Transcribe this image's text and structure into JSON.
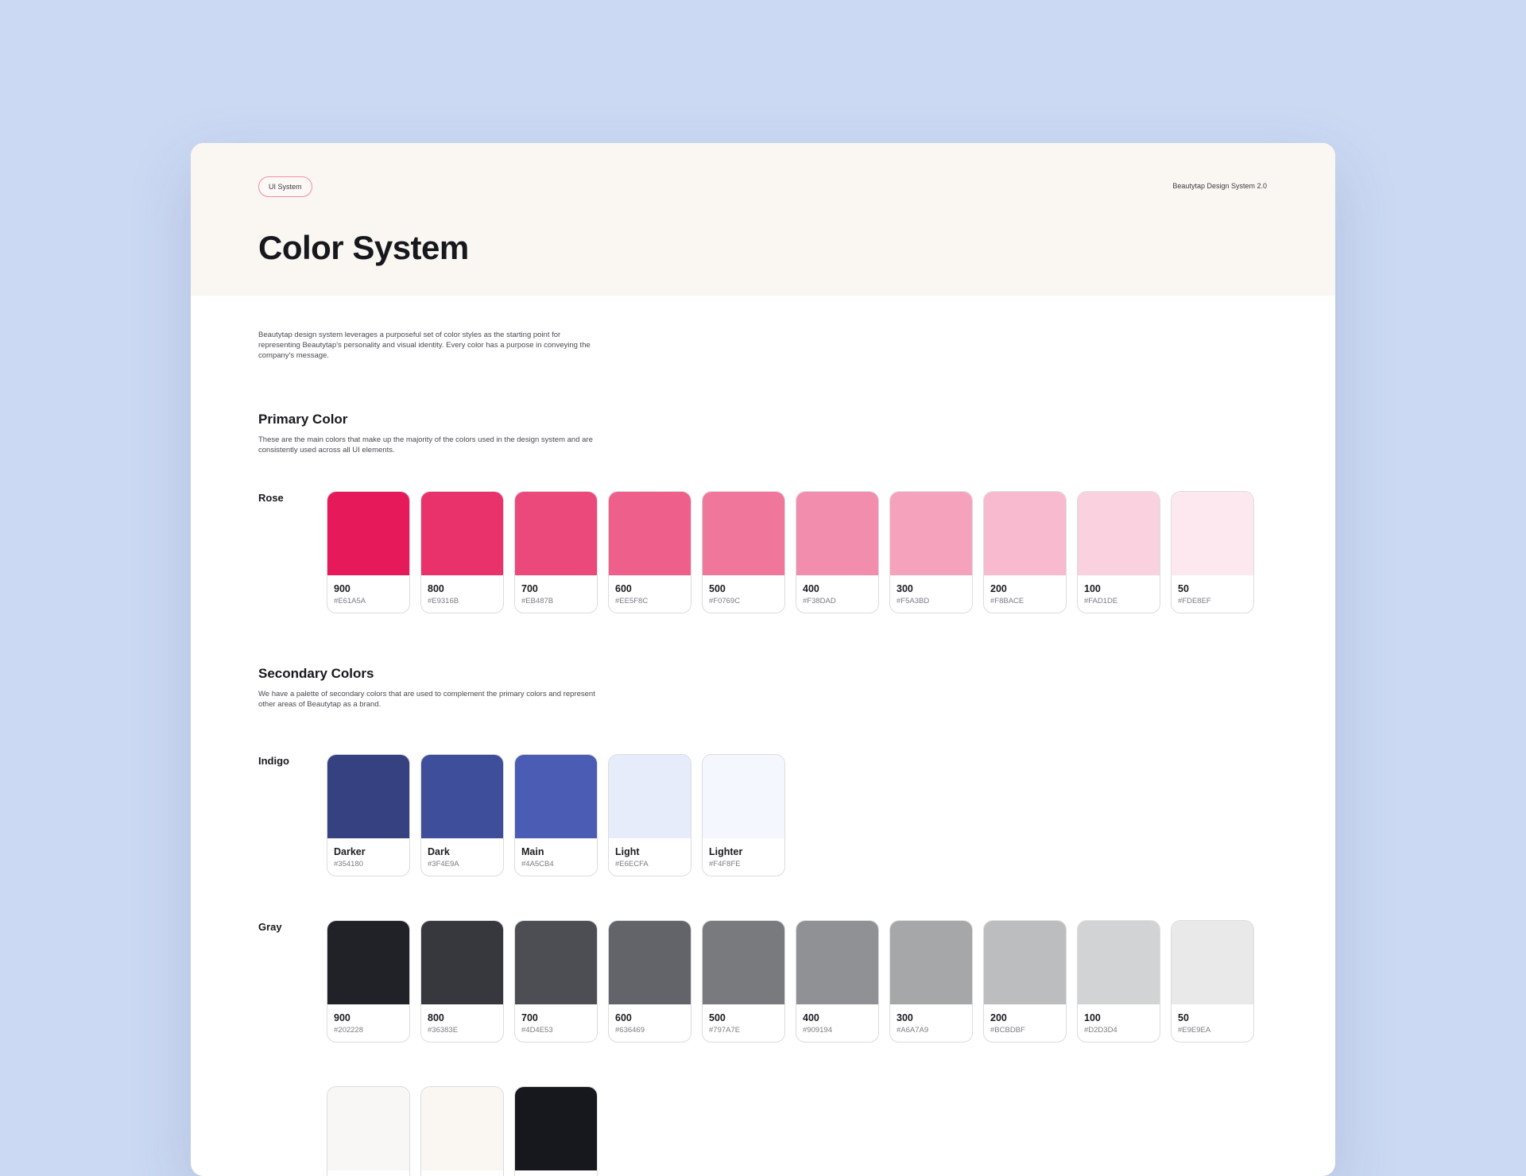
{
  "header": {
    "badge": "UI System",
    "meta": "Beautytap Design System 2.0",
    "title": "Color System"
  },
  "intro": "Beautytap design system leverages a purposeful set of color styles as the starting point for representing Beautytap's personality and visual identity. Every color has a purpose in conveying the company's message.",
  "primary": {
    "title": "Primary Color",
    "description": "These are the main colors that make up the majority of the colors used in the design system and are consistently used across all UI elements.",
    "groups": [
      {
        "label": "Rose",
        "swatches": [
          {
            "name": "900",
            "hex": "#E61A5A",
            "color": "#E61A5A"
          },
          {
            "name": "800",
            "hex": "#E9316B",
            "color": "#E9316B"
          },
          {
            "name": "700",
            "hex": "#EB487B",
            "color": "#EB487B"
          },
          {
            "name": "600",
            "hex": "#EE5F8C",
            "color": "#EE5F8C"
          },
          {
            "name": "500",
            "hex": "#F0769C",
            "color": "#F0769C"
          },
          {
            "name": "400",
            "hex": "#F38DAD",
            "color": "#F38DAD"
          },
          {
            "name": "300",
            "hex": "#F5A3BD",
            "color": "#F5A3BD"
          },
          {
            "name": "200",
            "hex": "#F8BACE",
            "color": "#F8BACE"
          },
          {
            "name": "100",
            "hex": "#FAD1DE",
            "color": "#FAD1DE"
          },
          {
            "name": "50",
            "hex": "#FDE8EF",
            "color": "#FDE8EF"
          }
        ]
      }
    ]
  },
  "secondary": {
    "title": "Secondary Colors",
    "description": "We have a palette of secondary colors that are used to complement the primary colors and represent other areas of Beautytap as a brand.",
    "groups": [
      {
        "label": "Indigo",
        "swatches": [
          {
            "name": "Darker",
            "hex": "#354180",
            "color": "#354180"
          },
          {
            "name": "Dark",
            "hex": "#3F4E9A",
            "color": "#3F4E9A"
          },
          {
            "name": "Main",
            "hex": "#4A5CB4",
            "color": "#4A5CB4"
          },
          {
            "name": "Light",
            "hex": "#E6ECFA",
            "color": "#E6ECFA"
          },
          {
            "name": "Lighter",
            "hex": "#F4F8FE",
            "color": "#F4F8FE"
          }
        ]
      },
      {
        "label": "Gray",
        "swatches": [
          {
            "name": "900",
            "hex": "#202228",
            "color": "#202228"
          },
          {
            "name": "800",
            "hex": "#36383E",
            "color": "#36383E"
          },
          {
            "name": "700",
            "hex": "#4D4E53",
            "color": "#4D4E53"
          },
          {
            "name": "600",
            "hex": "#636469",
            "color": "#636469"
          },
          {
            "name": "500",
            "hex": "#797A7E",
            "color": "#797A7E"
          },
          {
            "name": "400",
            "hex": "#909194",
            "color": "#909194"
          },
          {
            "name": "300",
            "hex": "#A6A7A9",
            "color": "#A6A7A9"
          },
          {
            "name": "200",
            "hex": "#BCBDBF",
            "color": "#BCBDBF"
          },
          {
            "name": "100",
            "hex": "#D2D3D4",
            "color": "#D2D3D4"
          },
          {
            "name": "50",
            "hex": "#E9E9EA",
            "color": "#E9E9EA"
          }
        ]
      }
    ]
  },
  "extra_swatches": [
    {
      "color": "#F8F7F5"
    },
    {
      "color": "#FAF6F2"
    },
    {
      "color": "#17181D"
    }
  ]
}
